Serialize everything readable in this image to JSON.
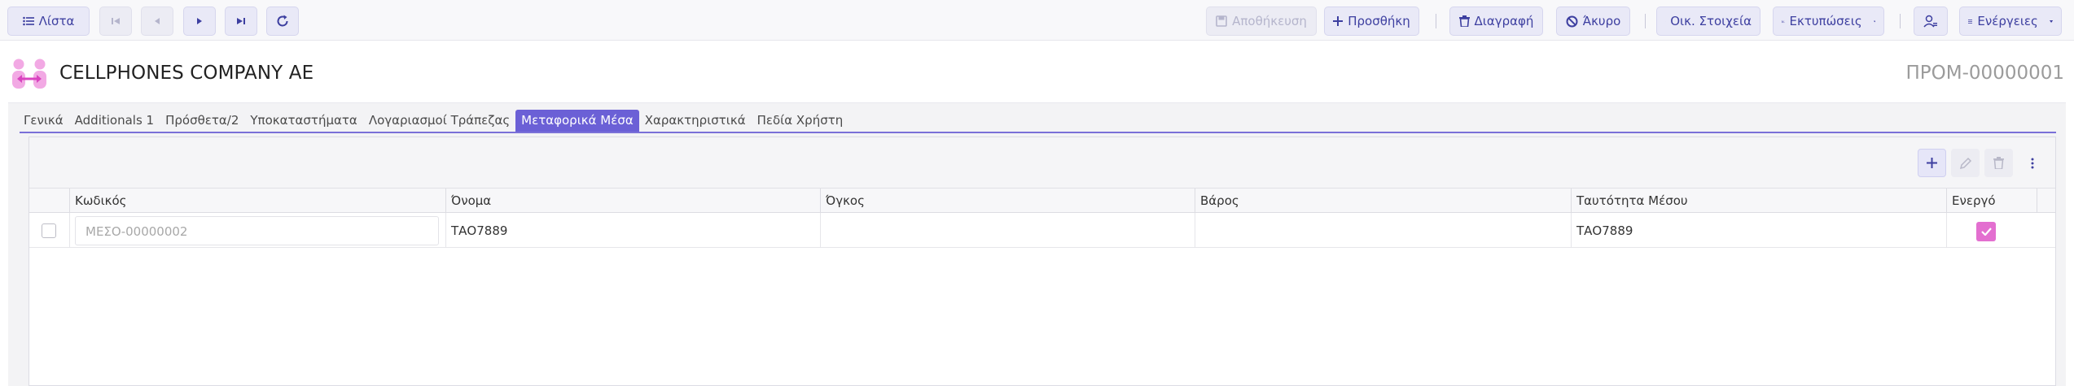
{
  "toolbar": {
    "list_label": "Λίστα",
    "save_label": "Αποθήκευση",
    "add_label": "Προσθήκη",
    "delete_label": "Διαγραφή",
    "cancel_label": "Άκυρο",
    "financials_label": "Οικ. Στοιχεία",
    "prints_label": "Εκτυπώσεις",
    "actions_label": "Ενέργειες"
  },
  "header": {
    "company_name": "CELLPHONES COMPANY AE",
    "doc_number": "ΠΡΟΜ-00000001"
  },
  "tabs": [
    {
      "label": "Γενικά"
    },
    {
      "label": "Additionals 1"
    },
    {
      "label": "Πρόσθετα/2"
    },
    {
      "label": "Υποκαταστήματα"
    },
    {
      "label": "Λογαριασμοί Τράπεζας"
    },
    {
      "label": "Μεταφορικά Μέσα"
    },
    {
      "label": "Χαρακτηριστικά"
    },
    {
      "label": "Πεδία Χρήστη"
    }
  ],
  "active_tab": "Μεταφορικά Μέσα",
  "grid": {
    "columns": [
      "Κωδικός",
      "Όνομα",
      "Όγκος",
      "Βάρος",
      "Ταυτότητα Μέσου",
      "Ενεργό"
    ],
    "rows": [
      {
        "code": "ΜΕΣΟ-00000002",
        "name": "ΤΑΟ7889",
        "volume": "",
        "weight": "",
        "vehicle_id": "ΤΑΟ7889",
        "active": true
      }
    ]
  },
  "colors": {
    "accent": "#6b60d6",
    "button_text": "#3d3fa0",
    "active_checkbox": "#e36fd0"
  }
}
